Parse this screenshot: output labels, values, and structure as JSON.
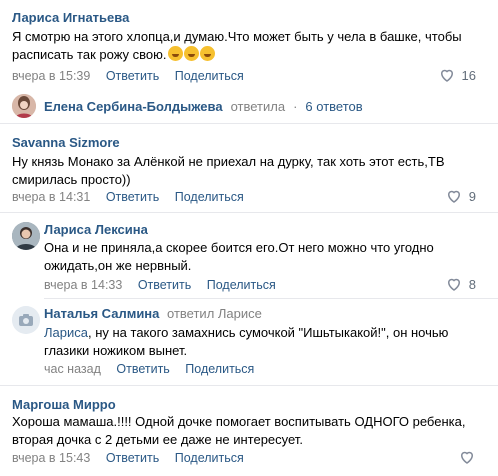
{
  "colors": {
    "link": "#2a5885",
    "meta": "#828282",
    "divider": "#e7e8ec"
  },
  "comments": [
    {
      "author": "Лариса Игнатьева",
      "text_line1": "Я смотрю на этого хлопца,и думаю.Что может быть у чела в башке, чтобы",
      "text_line2": "расписать так рожу свою.",
      "emoji": [
        "rofl-emoji",
        "rofl-emoji",
        "rofl-emoji"
      ],
      "time": "вчера в 15:39",
      "reply": "Ответить",
      "share": "Поделиться",
      "likes": "16"
    },
    {
      "author": "Savanna Sizmore",
      "text_line1": "Ну князь Монако за Алёнкой не приехал на дурку, так хоть этот есть,ТВ",
      "text_line2": "смирилась просто))",
      "time": "вчера в 14:31",
      "reply": "Ответить",
      "share": "Поделиться",
      "likes": "9"
    },
    {
      "author": "Лариса Лексина",
      "text_line1": "Она и не приняла,а скорее боится его.От него можно что угодно",
      "text_line2": "ожидать,он же нервный.",
      "time": "вчера в 14:33",
      "reply": "Ответить",
      "share": "Поделиться",
      "likes": "8"
    },
    {
      "author": "Наталья Салмина",
      "replied_to": "ответил Ларисе",
      "addressee": "Лариса",
      "text_line1_rest": ", ну на такого замахнись сумочкой \"Ишьтыкакой!\", он ночью",
      "text_line2": "глазики ножиком вынет.",
      "time": "час назад",
      "reply": "Ответить",
      "share": "Поделиться"
    },
    {
      "author": "Маргоша Мирро",
      "text_line1": "Хороша мамаша.!!!! Одной дочке помогает воспитывать ОДНОГО ребенка,",
      "text_line2": "вторая дочка с 2 детьми ее даже не интересует.",
      "time": "вчера в 15:43",
      "reply": "Ответить",
      "share": "Поделиться"
    }
  ],
  "thread": {
    "author": "Елена Сербина-Болдыжева",
    "action": "ответила",
    "separator": "·",
    "count": "6 ответов"
  }
}
